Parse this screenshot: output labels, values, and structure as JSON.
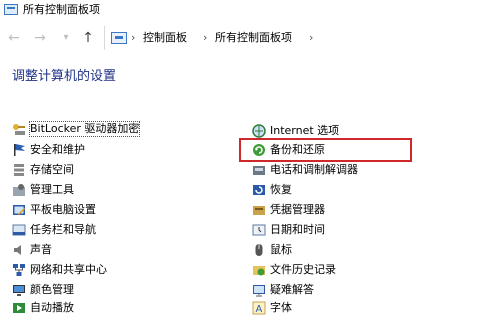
{
  "window": {
    "title": "所有控制面板项"
  },
  "address": {
    "crumbs": [
      "控制面板",
      "所有控制面板项"
    ]
  },
  "main": {
    "heading": "调整计算机的设置"
  },
  "items_left": [
    {
      "label": "BitLocker 驱动器加密",
      "icon": "key-drive-icon"
    },
    {
      "label": "安全和维护",
      "icon": "flag-icon"
    },
    {
      "label": "存储空间",
      "icon": "storage-icon"
    },
    {
      "label": "管理工具",
      "icon": "tools-icon"
    },
    {
      "label": "平板电脑设置",
      "icon": "tablet-icon"
    },
    {
      "label": "任务栏和导航",
      "icon": "taskbar-icon"
    },
    {
      "label": "声音",
      "icon": "speaker-icon"
    },
    {
      "label": "网络和共享中心",
      "icon": "network-icon"
    },
    {
      "label": "颜色管理",
      "icon": "color-monitor-icon"
    },
    {
      "label": "自动播放",
      "icon": "autoplay-icon"
    }
  ],
  "items_right": [
    {
      "label": "Internet 选项",
      "icon": "internet-options-icon"
    },
    {
      "label": "备份和还原",
      "icon": "backup-icon"
    },
    {
      "label": "电话和调制解调器",
      "icon": "phone-modem-icon"
    },
    {
      "label": "恢复",
      "icon": "recovery-icon"
    },
    {
      "label": "凭据管理器",
      "icon": "credential-icon"
    },
    {
      "label": "日期和时间",
      "icon": "clock-icon"
    },
    {
      "label": "鼠标",
      "icon": "mouse-icon"
    },
    {
      "label": "文件历史记录",
      "icon": "file-history-icon"
    },
    {
      "label": "疑难解答",
      "icon": "troubleshoot-icon"
    },
    {
      "label": "字体",
      "icon": "font-icon"
    }
  ],
  "colors": {
    "heading": "#1e3287",
    "highlight": "#d0282a"
  }
}
